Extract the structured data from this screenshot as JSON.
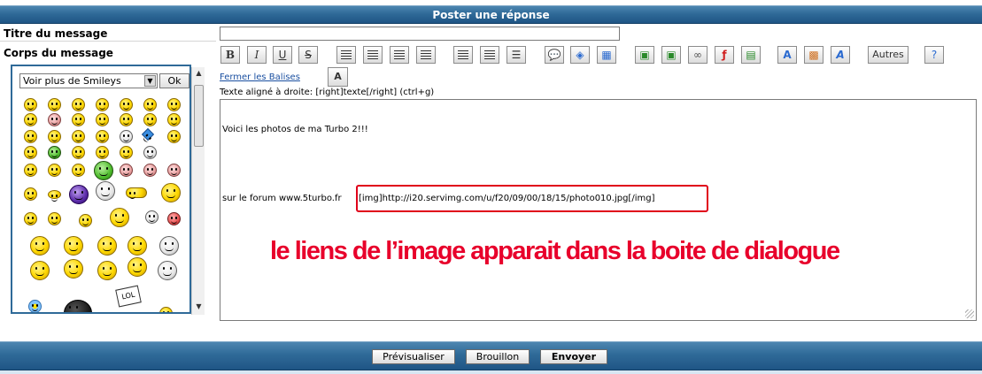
{
  "header": {
    "title": "Poster une réponse"
  },
  "fields": {
    "title_label": "Titre du message",
    "body_label": "Corps du message",
    "title_value": ""
  },
  "smileys": {
    "select_value": "Voir plus de Smileys",
    "ok_label": "Ok"
  },
  "toolbar": {
    "bold": "B",
    "italic": "I",
    "underline": "U",
    "strike": "S",
    "autres": "Autres",
    "close_tags": "Fermer les Balises",
    "font_size_icon": "A",
    "help_text": "Texte aligné à droite: [right]texte[/right] (ctrl+g)",
    "icons": [
      "align-left-icon",
      "align-center-icon",
      "align-right-icon",
      "justify-icon",
      "bullet-list-icon",
      "numbered-list-icon",
      "horizontal-rule-icon",
      "quote-icon",
      "code-icon",
      "table-icon",
      "image-host-icon",
      "image-icon",
      "link-icon",
      "flash-icon",
      "video-icon",
      "font-icon",
      "color-icon",
      "font-style-icon",
      "help-icon"
    ]
  },
  "message": {
    "line1": "Voici les photos de ma Turbo 2!!!",
    "line2_prefix": "sur le forum www.5turbo.fr",
    "img_code": "[img]http://i20.servimg.com/u/f20/09/00/18/15/photo010.jpg[/img]",
    "annotation": "le liens de l’image apparait dans la boite de dialogue"
  },
  "footer": {
    "preview": "Prévisualiser",
    "draft": "Brouillon",
    "send": "Envoyer"
  },
  "colors": {
    "bar": "#2f6a98",
    "annotation": "#e8002b",
    "highlight_box": "#e0001a",
    "link": "#1a4fa0"
  }
}
